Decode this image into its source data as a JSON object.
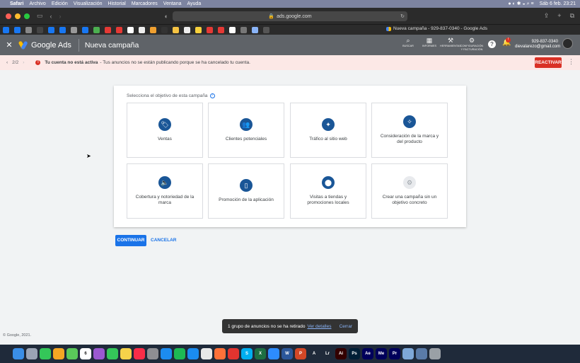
{
  "menubar": {
    "app": "Safari",
    "items": [
      "Archivo",
      "Edición",
      "Visualización",
      "Historial",
      "Marcadores",
      "Ventana",
      "Ayuda"
    ],
    "datetime": "Sáb 6 feb.  23:21"
  },
  "browser": {
    "url": "ads.google.com",
    "tab_title": "Nueva campaña - 929-837-0340 - Google Ads"
  },
  "ads_header": {
    "brand": "Google Ads",
    "page_title": "Nueva campaña",
    "tools": [
      {
        "icon": "search-icon",
        "glyph": "⌕",
        "label": "BUSCAR"
      },
      {
        "icon": "reports-icon",
        "glyph": "▦",
        "label": "INFORMES"
      },
      {
        "icon": "wrench-icon",
        "glyph": "⚒",
        "label": "HERRAMIENTAS"
      },
      {
        "icon": "gear-icon",
        "glyph": "⚙",
        "label": "CONFIGURACIÓN Y FACTURACIÓN"
      }
    ],
    "help_glyph": "?",
    "bell_badge": "!",
    "account_id": "929-837-0340",
    "account_email": "dievalarezo@gmail.com"
  },
  "alert": {
    "pager": "2/2",
    "title": "Tu cuenta no está activa",
    "message": "- Tus anuncios no se están publicando porque se ha cancelado tu cuenta.",
    "action": "REACTIVAR"
  },
  "objectives": {
    "heading": "Selecciona el objetivo de esta campaña",
    "tiles": [
      {
        "label": "Ventas",
        "icon": "tag-icon",
        "glyph": "🏷"
      },
      {
        "label": "Clientes potenciales",
        "icon": "people-icon",
        "glyph": "👥"
      },
      {
        "label": "Tráfico al sitio web",
        "icon": "cursor-click-icon",
        "glyph": "✦"
      },
      {
        "label": "Consideración de la marca y del producto",
        "icon": "sparkle-icon",
        "glyph": "✧"
      },
      {
        "label": "Cobertura y notoriedad de la marca",
        "icon": "speaker-icon",
        "glyph": "🔈"
      },
      {
        "label": "Promoción de la aplicación",
        "icon": "phone-icon",
        "glyph": "▯"
      },
      {
        "label": "Visitas a tiendas y promociones locales",
        "icon": "location-pin-icon",
        "glyph": "⬤"
      },
      {
        "label": "Crear una campaña sin un objetivo concreto",
        "icon": "gear-icon",
        "glyph": "⚙"
      }
    ]
  },
  "actions": {
    "continue": "CONTINUAR",
    "cancel": "CANCELAR"
  },
  "footer": "© Google, 2021.",
  "snackbar": {
    "text": "1 grupo de anuncios no se ha retirado",
    "link": "Ver detalles",
    "close": "Cerrar"
  },
  "dock": [
    {
      "name": "finder",
      "color": "#3a8ee6",
      "glyph": ""
    },
    {
      "name": "launchpad",
      "color": "#9aa4b5",
      "glyph": ""
    },
    {
      "name": "facetime",
      "color": "#34c759",
      "glyph": ""
    },
    {
      "name": "photos",
      "color": "#f5a623",
      "glyph": ""
    },
    {
      "name": "maps",
      "color": "#5ac85a",
      "glyph": ""
    },
    {
      "name": "calendar",
      "color": "#ffffff",
      "glyph": "6"
    },
    {
      "name": "podcasts",
      "color": "#9b59d0",
      "glyph": ""
    },
    {
      "name": "messages",
      "color": "#34c759",
      "glyph": ""
    },
    {
      "name": "notes",
      "color": "#f6d34a",
      "glyph": ""
    },
    {
      "name": "music",
      "color": "#fa2d48",
      "glyph": ""
    },
    {
      "name": "settings",
      "color": "#8e8e93",
      "glyph": ""
    },
    {
      "name": "app-store",
      "color": "#1c8cf0",
      "glyph": ""
    },
    {
      "name": "spotify",
      "color": "#1db954",
      "glyph": ""
    },
    {
      "name": "safari",
      "color": "#1a8cf0",
      "glyph": ""
    },
    {
      "name": "chrome",
      "color": "#e8e8e8",
      "glyph": ""
    },
    {
      "name": "firefox",
      "color": "#ff7139",
      "glyph": ""
    },
    {
      "name": "office",
      "color": "#e3342f",
      "glyph": ""
    },
    {
      "name": "skype",
      "color": "#00aff0",
      "glyph": "S"
    },
    {
      "name": "excel",
      "color": "#1d6f42",
      "glyph": "X"
    },
    {
      "name": "zoom",
      "color": "#2d8cff",
      "glyph": ""
    },
    {
      "name": "word",
      "color": "#2b579a",
      "glyph": "W"
    },
    {
      "name": "powerpoint",
      "color": "#d24726",
      "glyph": "P"
    },
    {
      "name": "acrobat",
      "color": "#1f2a3a",
      "glyph": "A"
    },
    {
      "name": "lightroom",
      "color": "#1f2a3a",
      "glyph": "Lr"
    },
    {
      "name": "illustrator",
      "color": "#330000",
      "glyph": "Ai"
    },
    {
      "name": "photoshop",
      "color": "#001e36",
      "glyph": "Ps"
    },
    {
      "name": "after-effects",
      "color": "#00005b",
      "glyph": "Ae"
    },
    {
      "name": "media-encoder",
      "color": "#00005b",
      "glyph": "Me"
    },
    {
      "name": "premiere",
      "color": "#00005b",
      "glyph": "Pr"
    },
    {
      "name": "preview",
      "color": "#7ea8d8",
      "glyph": ""
    },
    {
      "name": "downloads",
      "color": "#5a7ba8",
      "glyph": ""
    },
    {
      "name": "trash",
      "color": "#9aa0a6",
      "glyph": ""
    }
  ]
}
